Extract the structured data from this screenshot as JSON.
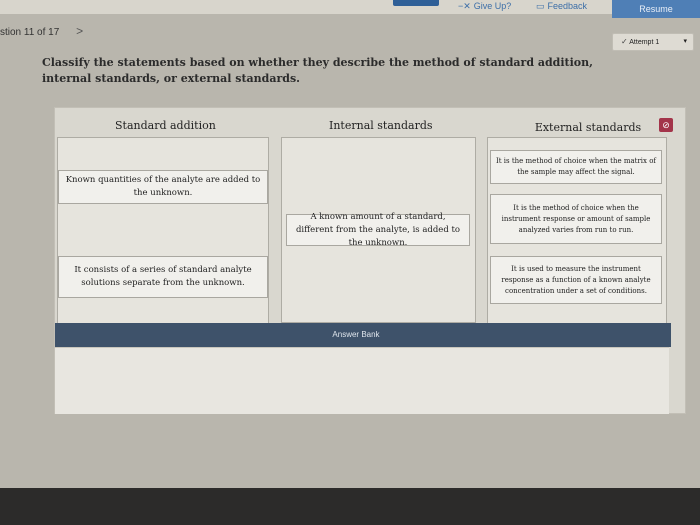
{
  "topbar": {
    "give_up": "Give Up?",
    "give_up_icon": "x-icon",
    "feedback": "Feedback",
    "feedback_icon": "comment-icon",
    "resume": "Resume"
  },
  "question": {
    "counter": "stion 11 of 17",
    "next_symbol": ">",
    "attempt_icon": "✓",
    "attempt": "Attempt 1",
    "attempt_caret": "▾",
    "prompt": "Classify the statements based on whether they describe the method of standard addition, internal standards, or external standards."
  },
  "columns": [
    {
      "title": "Standard addition"
    },
    {
      "title": "Internal standards"
    },
    {
      "title": "External standards"
    }
  ],
  "cards": {
    "standard_addition": [
      "Known quantities of the analyte are added to the unknown.",
      "It consists of a series of standard analyte solutions separate from the unknown."
    ],
    "internal_standards": [
      "A known amount of a standard, different from the analyte, is added to the unknown."
    ],
    "external_standards": [
      "It is the method of choice when the matrix of the sample may affect the signal.",
      "It is the method of choice when the instrument response or amount of sample analyzed varies from run to run.",
      "It is used to measure the instrument response as a function of a known analyte concentration under a set of conditions."
    ]
  },
  "badge_symbol": "⊘",
  "answer_bank": {
    "label": "Answer Bank"
  },
  "colors": {
    "accent": "#4f7fb6",
    "badge": "#a3344a",
    "answer_bank_bar": "#3e526a"
  }
}
